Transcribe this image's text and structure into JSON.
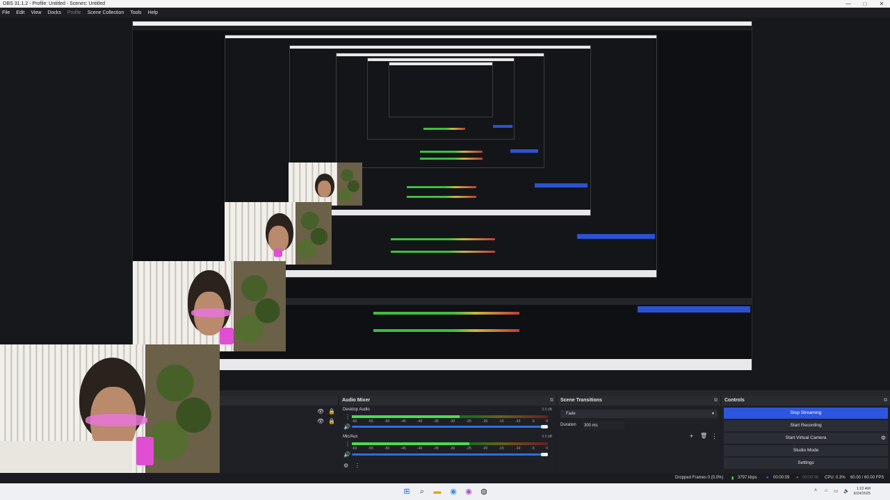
{
  "window": {
    "title": "OBS 31.1.2 - Profile: Untitled - Scenes: Untitled",
    "controls": [
      "—",
      "□",
      "✕"
    ]
  },
  "menu": [
    {
      "label": "File",
      "enabled": true
    },
    {
      "label": "Edit",
      "enabled": true
    },
    {
      "label": "View",
      "enabled": true
    },
    {
      "label": "Docks",
      "enabled": true
    },
    {
      "label": "Profile",
      "enabled": false
    },
    {
      "label": "Scene Collection",
      "enabled": true
    },
    {
      "label": "Tools",
      "enabled": true
    },
    {
      "label": "Help",
      "enabled": true
    }
  ],
  "audio_mixer": {
    "title": "Audio Mixer",
    "ticks": [
      "-60",
      "-55",
      "-50",
      "-45",
      "-40",
      "-35",
      "-30",
      "-25",
      "-20",
      "-15",
      "-10",
      "-5",
      "0"
    ],
    "channels": [
      {
        "name": "Desktop Audio",
        "db": "0.0 dB",
        "level": 0.55,
        "volume": 1.0
      },
      {
        "name": "Mic/Aux",
        "db": "0.0 dB",
        "level": 0.6,
        "volume": 1.0
      }
    ]
  },
  "scene_transitions": {
    "title": "Scene Transitions",
    "selected": "Fade",
    "duration_label": "Duration",
    "duration_value": "300 ms"
  },
  "controls": {
    "title": "Controls",
    "buttons": [
      "Stop Streaming",
      "Start Recording",
      "Start Virtual Camera",
      "Studio Mode",
      "Settings"
    ]
  },
  "status": {
    "dropped_frames": "Dropped Frames 0 (0.0%)",
    "bitrate": "3797 kbps",
    "stream_time": "00:00:09",
    "rec_time": "00:00:00",
    "cpu": "CPU: 0.3%",
    "fps": "60.00 / 60.00 FPS"
  },
  "taskbar": {
    "time": "1:22 AM",
    "date": "9/24/2025"
  },
  "icons": {
    "windows": "windows-logo-icon",
    "search": "search-icon",
    "explorer": "folder-icon",
    "chrome": "chrome-icon",
    "obs": "obs-icon"
  }
}
